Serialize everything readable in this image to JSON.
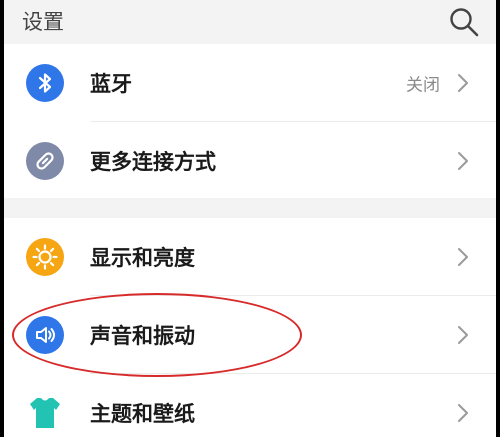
{
  "header": {
    "title": "设置"
  },
  "settings": [
    {
      "label": "蓝牙",
      "status": "关闭",
      "icon": "bluetooth-icon",
      "color": "#2f76e8"
    },
    {
      "label": "更多连接方式",
      "icon": "link-icon",
      "color": "#7f89a8"
    },
    {
      "label": "显示和亮度",
      "icon": "sun-icon",
      "color": "#f6a612"
    },
    {
      "label": "声音和振动",
      "icon": "speaker-icon",
      "color": "#2f76e8"
    },
    {
      "label": "主题和壁纸",
      "icon": "shirt-icon",
      "color": "#23c3b3"
    }
  ],
  "annotation": {
    "color": "#d72a2a",
    "target": "声音和振动"
  }
}
